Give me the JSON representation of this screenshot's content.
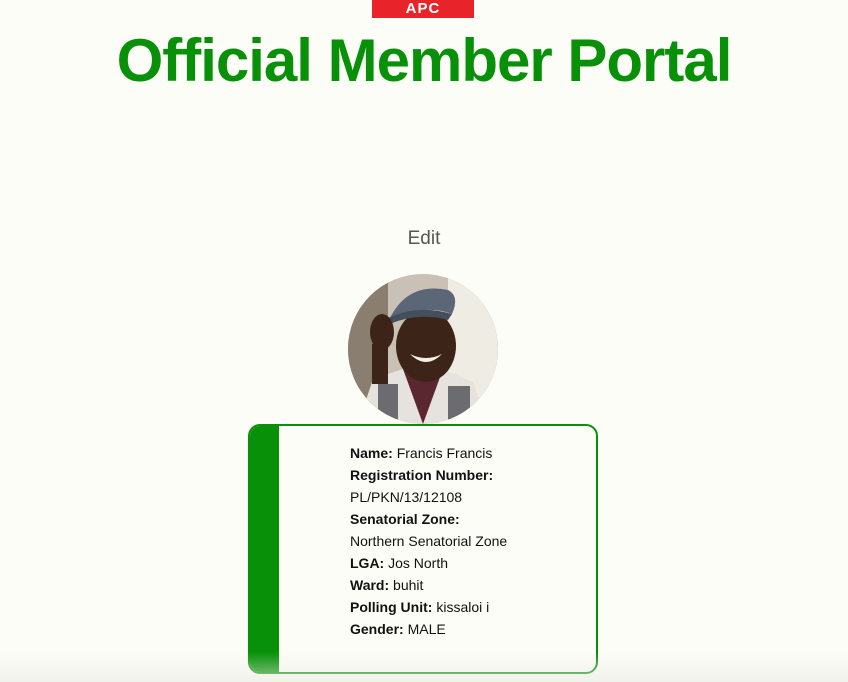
{
  "header": {
    "logo_text": "APC",
    "title": "Official Member Portal"
  },
  "edit_label": "Edit",
  "avatar": {
    "icon": "profile-photo"
  },
  "member": {
    "name_label": "Name:",
    "name": "Francis Francis",
    "reg_label": "Registration Number:",
    "reg": "PL/PKN/13/12108",
    "zone_label": "Senatorial Zone:",
    "zone": "Northern Senatorial Zone",
    "lga_label": "LGA:",
    "lga": "Jos North",
    "ward_label": "Ward:",
    "ward": "buhit",
    "pu_label": "Polling Unit:",
    "pu": "kissaloi i",
    "gender_label": "Gender:",
    "gender": "MALE"
  },
  "colors": {
    "brand_green": "#089108",
    "logo_red": "#e8242a",
    "background": "#fdfdf7"
  }
}
